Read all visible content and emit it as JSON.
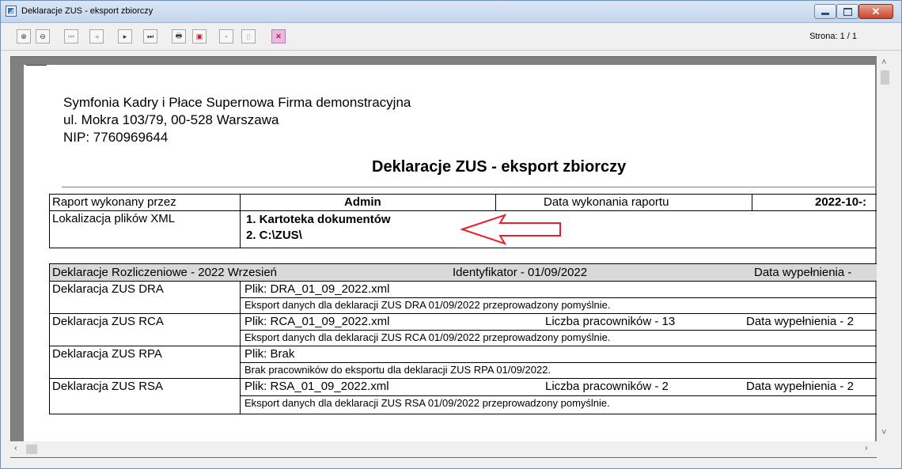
{
  "window": {
    "title": "Deklaracje ZUS - eksport zbiorczy"
  },
  "toolbar": {
    "buttons": [
      {
        "name": "zoom-in",
        "glyph": "⊕"
      },
      {
        "name": "zoom-out",
        "glyph": "⊖"
      },
      {
        "name": "first-page",
        "glyph": "⏮"
      },
      {
        "name": "prev-page",
        "glyph": "◂"
      },
      {
        "name": "next-page",
        "glyph": "▸"
      },
      {
        "name": "last-page",
        "glyph": "⏭"
      },
      {
        "name": "print",
        "glyph": "🖶"
      },
      {
        "name": "export-pdf",
        "glyph": "▣"
      },
      {
        "name": "save",
        "glyph": "▪"
      },
      {
        "name": "page-setup",
        "glyph": "▯"
      },
      {
        "name": "stop",
        "glyph": "✕"
      }
    ],
    "page_indicator": "Strona: 1 / 1"
  },
  "report": {
    "company_line1": "Symfonia Kadry i Płace Supernowa Firma demonstracyjna",
    "company_line2": "ul. Mokra 103/79, 00-528 Warszawa",
    "company_line3": "NIP: 7760969644",
    "title": "Deklaracje ZUS - eksport zbiorczy",
    "info": {
      "performed_by_label": "Raport wykonany przez",
      "performed_by_value": "Admin",
      "date_label": "Data wykonania raportu",
      "date_value": "2022-10-:",
      "location_label": "Lokalizacja plików XML",
      "location_1": "1. Kartoteka dokumentów",
      "location_2": "2. C:\\ZUS\\"
    },
    "declarations": {
      "header_left": "Deklaracje Rozliczeniowe - 2022 Wrzesień",
      "header_mid": "Identyfikator - 01/09/2022",
      "header_right": "Data wypełnienia -",
      "rows": [
        {
          "name": "Deklaracja ZUS DRA",
          "file": "Plik: DRA_01_09_2022.xml",
          "count": "",
          "filled": "",
          "message": "Eksport danych dla deklaracji ZUS DRA 01/09/2022 przeprowadzony pomyślnie."
        },
        {
          "name": "Deklaracja ZUS RCA",
          "file": "Plik: RCA_01_09_2022.xml",
          "count": "Liczba pracowników - 13",
          "filled": "Data wypełnienia - 2",
          "message": "Eksport danych dla deklaracji ZUS RCA 01/09/2022 przeprowadzony pomyślnie."
        },
        {
          "name": "Deklaracja ZUS RPA",
          "file": "Plik: Brak",
          "count": "",
          "filled": "",
          "message": "Brak pracowników do eksportu dla deklaracji ZUS RPA 01/09/2022."
        },
        {
          "name": "Deklaracja ZUS RSA",
          "file": "Plik: RSA_01_09_2022.xml",
          "count": "Liczba pracowników - 2",
          "filled": "Data wypełnienia - 2",
          "message": "Eksport danych dla deklaracji ZUS RSA 01/09/2022 przeprowadzony pomyślnie."
        }
      ]
    }
  },
  "colors": {
    "arrow": "#e8202a",
    "titlebar": "#c4d6ec",
    "viewer_bg": "#808080"
  }
}
